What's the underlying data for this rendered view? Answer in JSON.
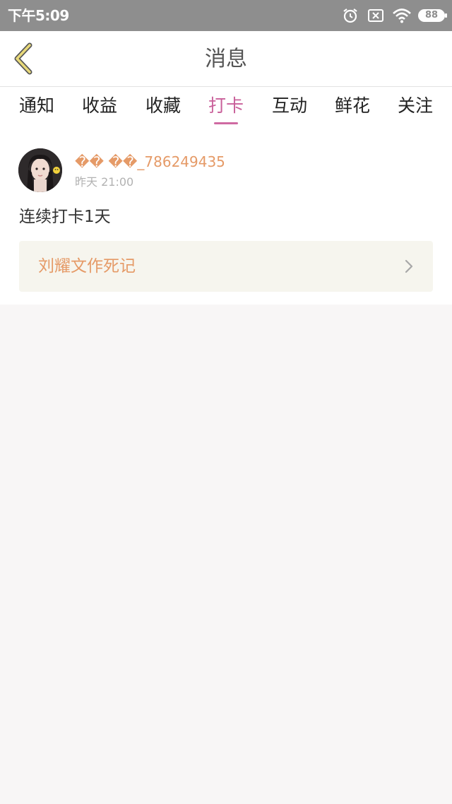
{
  "status_bar": {
    "time": "下午5:09",
    "icons": [
      "alarm-icon",
      "sim-off-icon",
      "wifi-icon",
      "battery-icon"
    ],
    "battery_level": "88"
  },
  "header": {
    "back_icon": "chevron-left-icon",
    "title": "消息"
  },
  "tabs": [
    {
      "label": "通知",
      "active": false
    },
    {
      "label": "收益",
      "active": false
    },
    {
      "label": "收藏",
      "active": false
    },
    {
      "label": "打卡",
      "active": true
    },
    {
      "label": "互动",
      "active": false
    },
    {
      "label": "鲜花",
      "active": false
    },
    {
      "label": "关注",
      "active": false
    }
  ],
  "messages": [
    {
      "username": "�� ��_786249435",
      "time": "昨天 21:00",
      "text": "连续打卡1天",
      "work_title": "刘耀文作死记"
    }
  ],
  "colors": {
    "accent_pink": "#c9609a",
    "username_orange": "#e59a67",
    "back_icon_yellow": "#e8d97a",
    "status_bar_gray": "#8e8e8e",
    "card_background": "#f6f5ee",
    "page_background": "#f8f6f6"
  }
}
